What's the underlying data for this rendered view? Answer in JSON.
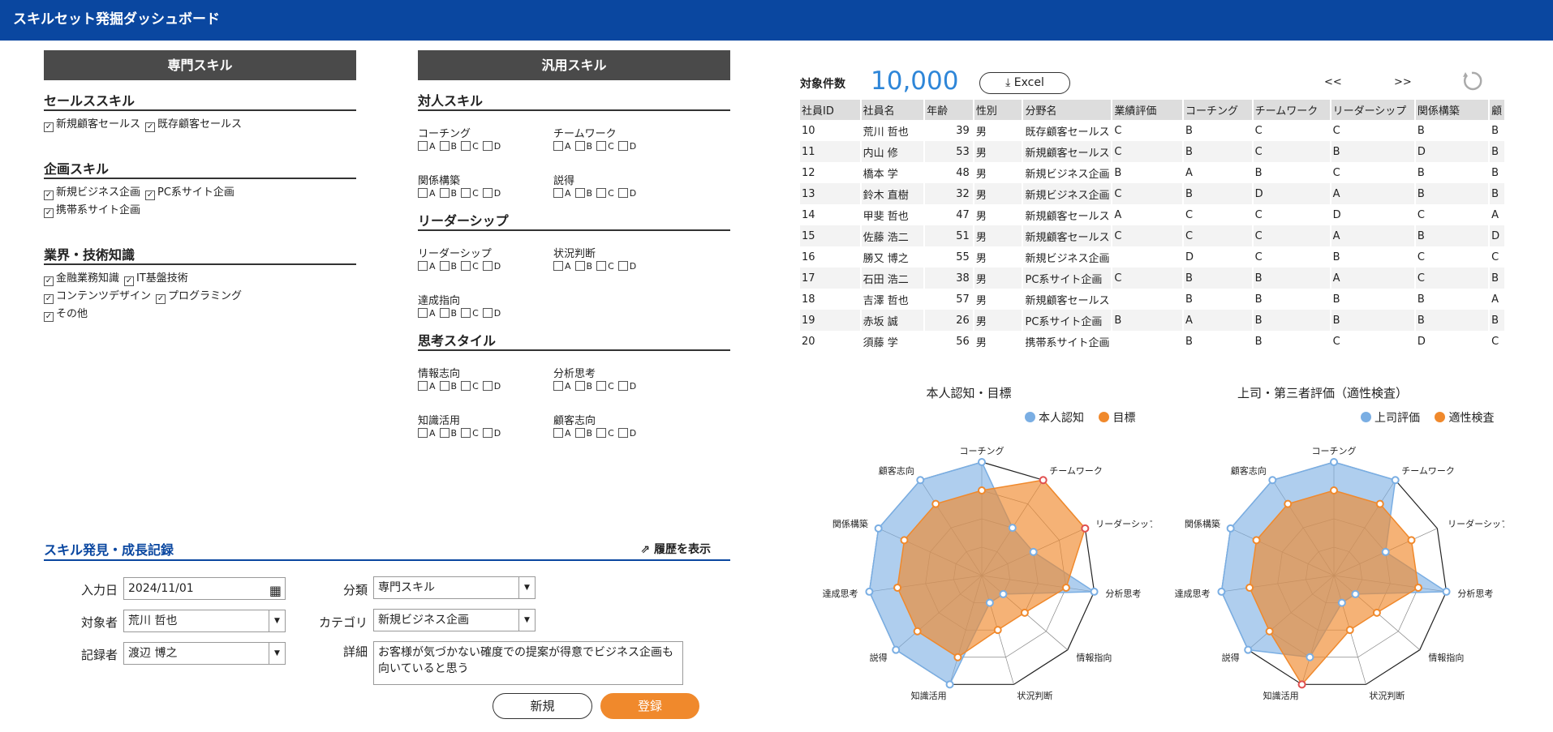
{
  "app": {
    "title": "スキルセット発掘ダッシュボード"
  },
  "specialty": {
    "header": "専門スキル",
    "sections": [
      {
        "title": "セールススキル",
        "rows": [
          [
            {
              "label": "新規顧客セールス",
              "checked": true
            },
            {
              "label": "既存顧客セールス",
              "checked": true
            }
          ]
        ]
      },
      {
        "title": "企画スキル",
        "rows": [
          [
            {
              "label": "新規ビジネス企画",
              "checked": true
            },
            {
              "label": "PC系サイト企画",
              "checked": true
            }
          ],
          [
            {
              "label": "携帯系サイト企画",
              "checked": true
            }
          ]
        ]
      },
      {
        "title": "業界・技術知識",
        "rows": [
          [
            {
              "label": "金融業務知識",
              "checked": true
            },
            {
              "label": "IT基盤技術",
              "checked": true
            }
          ],
          [
            {
              "label": "コンテンツデザイン",
              "checked": true
            },
            {
              "label": "プログラミング",
              "checked": true
            }
          ],
          [
            {
              "label": "その他",
              "checked": true
            }
          ]
        ]
      }
    ]
  },
  "general": {
    "header": "汎用スキル",
    "grades": [
      "A",
      "B",
      "C",
      "D"
    ],
    "sections": [
      {
        "title": "対人スキル",
        "skills": [
          "コーチング",
          "チームワーク",
          "関係構築",
          "説得"
        ]
      },
      {
        "title": "リーダーシップ",
        "skills": [
          "リーダーシップ",
          "状況判断",
          "達成指向"
        ]
      },
      {
        "title": "思考スタイル",
        "skills": [
          "情報志向",
          "分析思考",
          "知識活用",
          "顧客志向"
        ]
      }
    ]
  },
  "results": {
    "count_label": "対象件数",
    "count_value": "10,000",
    "excel_label": "Excel",
    "prev_label": "<<",
    "next_label": ">>",
    "columns": [
      "社員ID",
      "社員名",
      "年齢",
      "性別",
      "分野名",
      "業績評価",
      "コーチング",
      "チームワーク",
      "リーダーシップ",
      "関係構築",
      "顧"
    ],
    "rows": [
      [
        "10",
        "荒川 哲也",
        "39",
        "男",
        "既存顧客セールス",
        "C",
        "B",
        "C",
        "C",
        "B",
        "B"
      ],
      [
        "11",
        "内山 修",
        "53",
        "男",
        "新規顧客セールス",
        "C",
        "B",
        "C",
        "B",
        "D",
        "B"
      ],
      [
        "12",
        "橋本 学",
        "48",
        "男",
        "新規ビジネス企画",
        "B",
        "A",
        "B",
        "C",
        "B",
        "B"
      ],
      [
        "13",
        "鈴木 直樹",
        "32",
        "男",
        "新規ビジネス企画",
        "C",
        "B",
        "D",
        "A",
        "B",
        "B"
      ],
      [
        "14",
        "甲斐 哲也",
        "47",
        "男",
        "新規顧客セールス",
        "A",
        "C",
        "C",
        "D",
        "C",
        "A"
      ],
      [
        "15",
        "佐藤 浩二",
        "51",
        "男",
        "新規顧客セールス",
        "C",
        "C",
        "C",
        "A",
        "B",
        "D"
      ],
      [
        "16",
        "勝又 博之",
        "55",
        "男",
        "新規ビジネス企画",
        "",
        "D",
        "C",
        "B",
        "C",
        "C"
      ],
      [
        "17",
        "石田 浩二",
        "38",
        "男",
        "PC系サイト企画",
        "C",
        "B",
        "B",
        "A",
        "C",
        "B"
      ],
      [
        "18",
        "吉澤 哲也",
        "57",
        "男",
        "新規顧客セールス",
        "",
        "B",
        "B",
        "B",
        "B",
        "A"
      ],
      [
        "19",
        "赤坂 誠",
        "26",
        "男",
        "PC系サイト企画",
        "B",
        "A",
        "B",
        "B",
        "B",
        "B"
      ],
      [
        "20",
        "須藤 学",
        "56",
        "男",
        "携帯系サイト企画",
        "",
        "B",
        "B",
        "C",
        "D",
        "C"
      ]
    ]
  },
  "colors": {
    "blue": "#7aaee3",
    "orange": "#f0892c",
    "red": "#e05050",
    "header": "#0a47a0"
  },
  "chart_data": [
    {
      "type": "radar",
      "title": "本人認知・目標",
      "axes": [
        "コーチング",
        "チームワーク",
        "リーダーシップ",
        "分析思考",
        "情報指向",
        "状況判断",
        "知識活用",
        "説得",
        "達成思考",
        "関係構築",
        "顧客志向"
      ],
      "series": [
        {
          "name": "本人認知",
          "values": [
            4,
            2,
            2,
            4,
            1,
            1,
            4,
            4,
            4,
            4,
            4
          ]
        },
        {
          "name": "目標",
          "values": [
            3,
            4,
            4,
            3,
            2,
            2,
            3,
            3,
            3,
            3,
            3
          ]
        }
      ],
      "max": 4,
      "legend": "top-right"
    },
    {
      "type": "radar",
      "title": "上司・第三者評価（適性検査）",
      "axes": [
        "コーチング",
        "チームワーク",
        "リーダーシップ",
        "分析思考",
        "情報指向",
        "状況判断",
        "知識活用",
        "説得",
        "達成思考",
        "関係構築",
        "顧客志向"
      ],
      "series": [
        {
          "name": "上司評価",
          "values": [
            4,
            4,
            2,
            4,
            1,
            1,
            3,
            4,
            4,
            4,
            4
          ]
        },
        {
          "name": "適性検査",
          "values": [
            3,
            3,
            3,
            3,
            2,
            2,
            4,
            3,
            3,
            3,
            3
          ]
        }
      ],
      "max": 4,
      "legend": "top-right"
    }
  ],
  "record": {
    "title": "スキル発見・成長記録",
    "history_label": "履歴を表示",
    "date_label": "入力日",
    "date_value": "2024/11/01",
    "target_label": "対象者",
    "target_value": "荒川 哲也",
    "recorder_label": "記録者",
    "recorder_value": "渡辺 博之",
    "type_label": "分類",
    "type_value": "専門スキル",
    "category_label": "カテゴリ",
    "category_value": "新規ビジネス企画",
    "detail_label": "詳細",
    "detail_value": "お客様が気づかない確度での提案が得意でビジネス企画も向いていると思う",
    "new_label": "新規",
    "submit_label": "登録"
  }
}
